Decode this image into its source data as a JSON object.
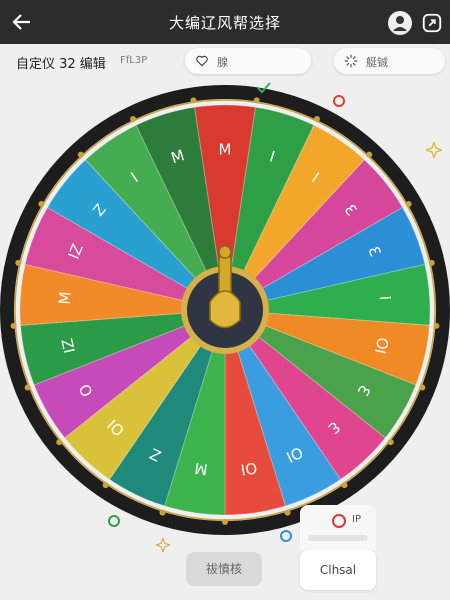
{
  "header": {
    "title": "大编辽风帮选择",
    "back_icon": "arrow-left-icon",
    "user_icon": "user-icon",
    "share_icon": "share-icon",
    "bg": "#2c2c2c"
  },
  "subheader": {
    "title": "自定仪 32 编辑",
    "meta": "FfL3P"
  },
  "pills": {
    "favorite": {
      "label": "腺",
      "icon": "heart-icon"
    },
    "loading": {
      "label": "艇铖",
      "icon": "spinner-icon"
    }
  },
  "wheel": {
    "segments": [
      {
        "color": "#d93a2f",
        "label": "M"
      },
      {
        "color": "#2f9f45",
        "label": "I"
      },
      {
        "color": "#f2a72b",
        "label": "I"
      },
      {
        "color": "#d4479a",
        "label": "Ɛ"
      },
      {
        "color": "#2b8fd6",
        "label": "Ɛ"
      },
      {
        "color": "#2eae4d",
        "label": "I"
      },
      {
        "color": "#f08a24",
        "label": "OI"
      },
      {
        "color": "#4aa34a",
        "label": "Ɛ"
      },
      {
        "color": "#e0468e",
        "label": "Ɛ"
      },
      {
        "color": "#3a9de0",
        "label": "OI"
      },
      {
        "color": "#e64b3c",
        "label": "OI"
      },
      {
        "color": "#3cb44b",
        "label": "M"
      },
      {
        "color": "#1f8a7a",
        "label": "Z"
      },
      {
        "color": "#d9c23a",
        "label": "OI"
      },
      {
        "color": "#c64ab8",
        "label": "O"
      },
      {
        "color": "#2c9b47",
        "label": "IZ"
      },
      {
        "color": "#f28a2a",
        "label": "M"
      },
      {
        "color": "#d84b9c",
        "label": "IZ"
      },
      {
        "color": "#2aa0d0",
        "label": "Z"
      },
      {
        "color": "#44ad52",
        "label": "I"
      },
      {
        "color": "#2d7d3a",
        "label": "M"
      }
    ],
    "hub_color": "#2f3542",
    "pointer_color": "#d4a92a",
    "rim_color": "#1d1d1d"
  },
  "ip_card": {
    "label": "IP"
  },
  "buttons": {
    "primary": "祓憤核",
    "secondary": "Clhsal"
  }
}
